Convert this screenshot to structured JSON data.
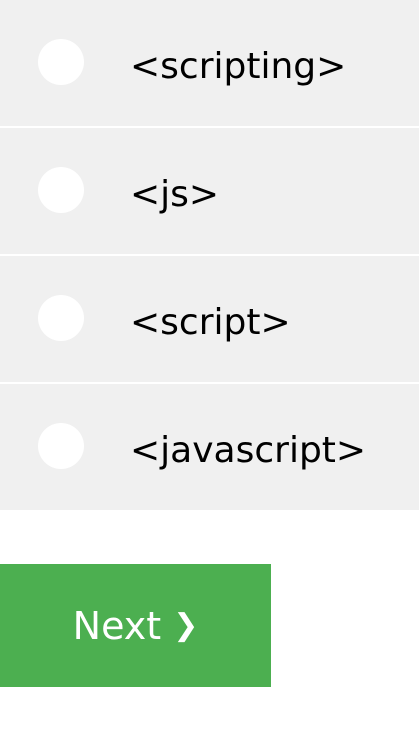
{
  "options": [
    {
      "label": "<scripting>"
    },
    {
      "label": "<js>"
    },
    {
      "label": "<script>"
    },
    {
      "label": "<javascript>"
    }
  ],
  "next_button": {
    "label": "Next",
    "icon": "chevron-right-icon",
    "icon_glyph": "❯",
    "color": "#4caf50"
  },
  "colors": {
    "option_background": "#f0f0f0",
    "radio_fill": "#ffffff",
    "button_background": "#4caf50",
    "button_text": "#ffffff"
  }
}
